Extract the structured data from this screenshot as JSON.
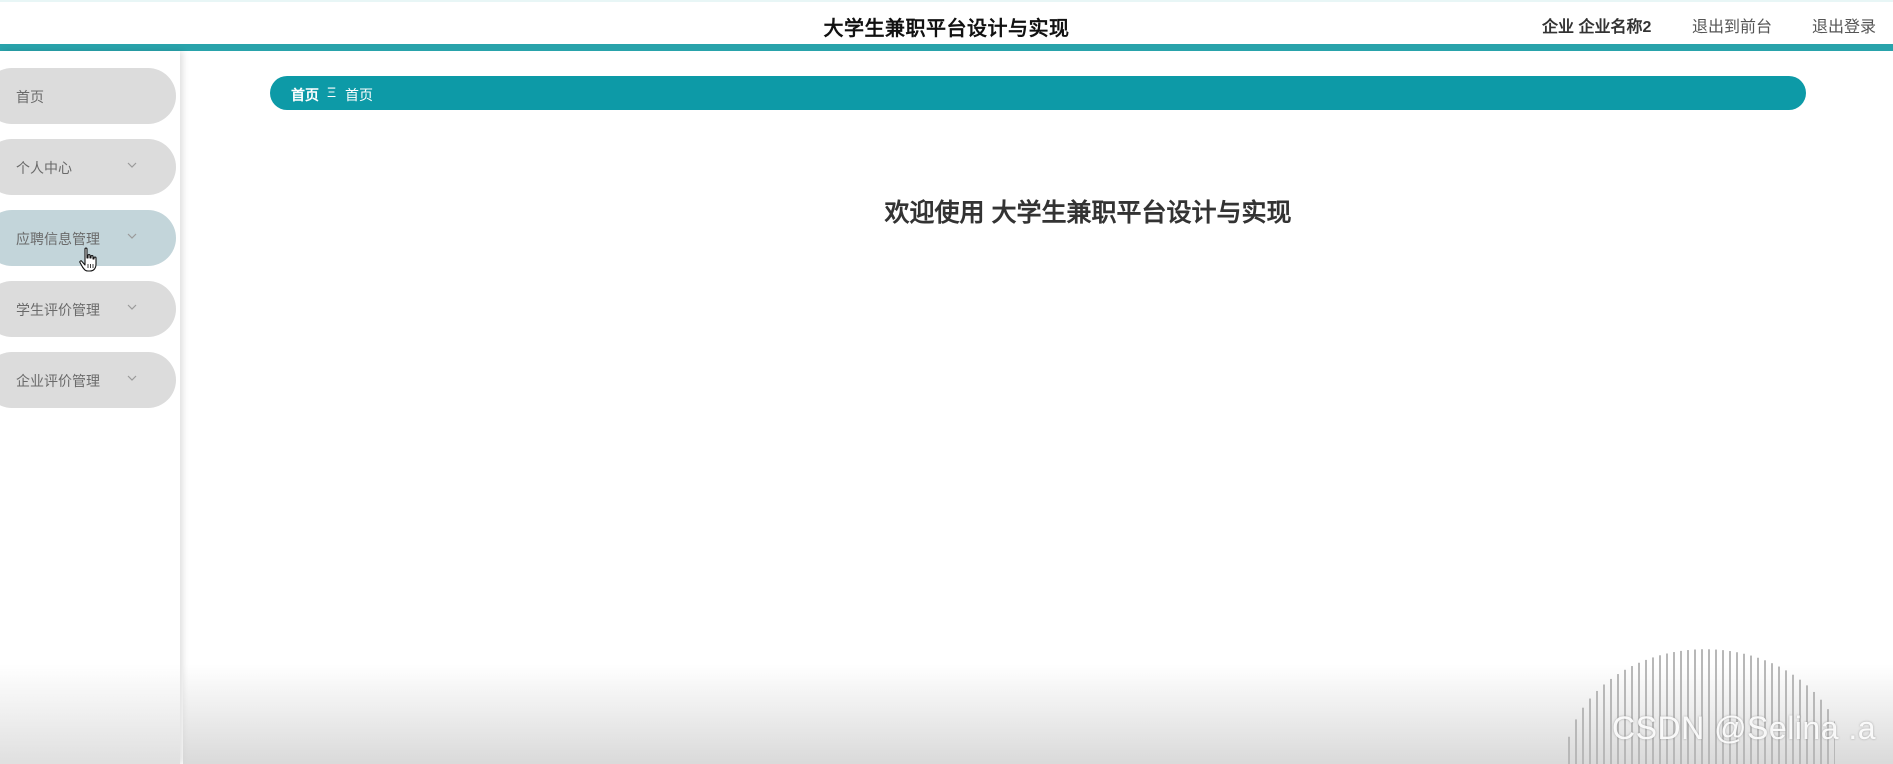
{
  "header": {
    "title": "大学生兼职平台设计与实现",
    "user_label": "企业 企业名称2",
    "front_link": "退出到前台",
    "logout_link": "退出登录"
  },
  "sidebar": {
    "items": [
      {
        "label": "首页",
        "has_chevron": false,
        "icon": "none"
      },
      {
        "label": "个人中心",
        "has_chevron": true,
        "icon": "chevron-down-icon"
      },
      {
        "label": "应聘信息管理",
        "has_chevron": true,
        "icon": "chevron-down-icon",
        "state": "hovered"
      },
      {
        "label": "学生评价管理",
        "has_chevron": true,
        "icon": "chevron-down-icon"
      },
      {
        "label": "企业评价管理",
        "has_chevron": true,
        "icon": "chevron-down-icon"
      }
    ]
  },
  "breadcrumb": {
    "home": "首页",
    "separator": "Ξ",
    "current": "首页"
  },
  "main": {
    "welcome_text": "欢迎使用 大学生兼职平台设计与实现"
  },
  "watermark": "CSDN @Selina .a",
  "colors": {
    "accent": "#0d9aa7",
    "stripe": "#29a3ab",
    "menu_bg": "#dcdcdc",
    "menu_hover_bg": "#c3d5da"
  }
}
